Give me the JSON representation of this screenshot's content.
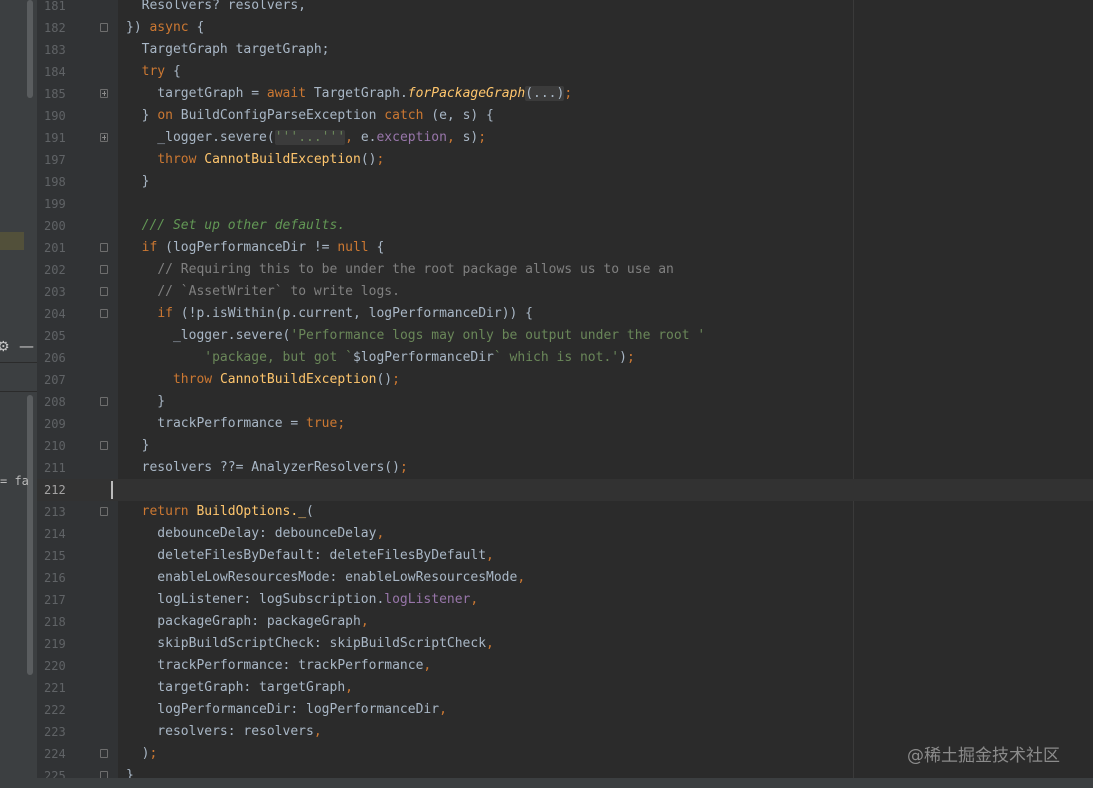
{
  "lines": [
    {
      "num": "181",
      "indent": 0,
      "fold": "",
      "parts": [
        [
          "",
          "  Resolvers? resolvers,"
        ]
      ]
    },
    {
      "num": "182",
      "indent": 0,
      "fold": "start",
      "parts": [
        [
          "",
          "}) "
        ],
        [
          "kw",
          "async"
        ],
        [
          "",
          " {"
        ]
      ]
    },
    {
      "num": "183",
      "indent": 0,
      "fold": "",
      "parts": [
        [
          "",
          "  TargetGraph targetGraph;"
        ]
      ]
    },
    {
      "num": "184",
      "indent": 0,
      "fold": "",
      "parts": [
        [
          "",
          "  "
        ],
        [
          "kw",
          "try"
        ],
        [
          "",
          " {"
        ]
      ]
    },
    {
      "num": "185",
      "indent": 0,
      "fold": "plus",
      "parts": [
        [
          "",
          "    targetGraph = "
        ],
        [
          "kw",
          "await"
        ],
        [
          "",
          " TargetGraph."
        ],
        [
          "fni",
          "forPackageGraph"
        ],
        [
          "fold-text",
          "(...)"
        ],
        [
          "kw",
          ";"
        ]
      ]
    },
    {
      "num": "190",
      "indent": 0,
      "fold": "",
      "parts": [
        [
          "",
          "  } "
        ],
        [
          "kw",
          "on"
        ],
        [
          "",
          " BuildConfigParseException "
        ],
        [
          "kw",
          "catch"
        ],
        [
          "",
          " (e, s) {"
        ]
      ]
    },
    {
      "num": "191",
      "indent": 0,
      "fold": "plus",
      "parts": [
        [
          "",
          "    _logger.severe("
        ],
        [
          "str-fold",
          "'''...'''"
        ],
        [
          "kw",
          ","
        ],
        [
          "",
          " e."
        ],
        [
          "prop",
          "exception"
        ],
        [
          "kw",
          ","
        ],
        [
          "",
          " s)"
        ],
        [
          "kw",
          ";"
        ]
      ]
    },
    {
      "num": "197",
      "indent": 0,
      "fold": "",
      "parts": [
        [
          "",
          "    "
        ],
        [
          "kw",
          "throw"
        ],
        [
          "",
          " "
        ],
        [
          "fn",
          "CannotBuildException"
        ],
        [
          "",
          "()"
        ],
        [
          "kw",
          ";"
        ]
      ]
    },
    {
      "num": "198",
      "indent": 0,
      "fold": "",
      "parts": [
        [
          "",
          "  }"
        ]
      ]
    },
    {
      "num": "199",
      "indent": 0,
      "fold": "",
      "parts": [
        [
          "",
          ""
        ]
      ]
    },
    {
      "num": "200",
      "indent": 0,
      "fold": "",
      "parts": [
        [
          "",
          "  "
        ],
        [
          "doc",
          "/// Set up other defaults."
        ]
      ]
    },
    {
      "num": "201",
      "indent": 0,
      "fold": "start",
      "parts": [
        [
          "",
          "  "
        ],
        [
          "kw",
          "if"
        ],
        [
          "",
          " (logPerformanceDir != "
        ],
        [
          "kw",
          "null"
        ],
        [
          "",
          " {"
        ]
      ]
    },
    {
      "num": "202",
      "indent": 0,
      "fold": "start",
      "parts": [
        [
          "",
          "    "
        ],
        [
          "cm",
          "// Requiring this to be under the root package allows us to use an"
        ]
      ]
    },
    {
      "num": "203",
      "indent": 0,
      "fold": "end",
      "parts": [
        [
          "",
          "    "
        ],
        [
          "cm",
          "// `AssetWriter` to write logs."
        ]
      ]
    },
    {
      "num": "204",
      "indent": 0,
      "fold": "start",
      "parts": [
        [
          "",
          "    "
        ],
        [
          "kw",
          "if"
        ],
        [
          "",
          " (!p.isWithin(p.current, logPerformanceDir)) {"
        ]
      ]
    },
    {
      "num": "205",
      "indent": 0,
      "fold": "",
      "parts": [
        [
          "",
          "      _logger.severe("
        ],
        [
          "str",
          "'Performance logs may only be output under the root '"
        ]
      ]
    },
    {
      "num": "206",
      "indent": 0,
      "fold": "",
      "parts": [
        [
          "",
          "          "
        ],
        [
          "str",
          "'package, but got `"
        ],
        [
          "",
          "$logPerformanceDir"
        ],
        [
          "str",
          "` which is not.'"
        ],
        [
          "",
          ")"
        ],
        [
          "kw",
          ";"
        ]
      ]
    },
    {
      "num": "207",
      "indent": 0,
      "fold": "",
      "parts": [
        [
          "",
          "      "
        ],
        [
          "kw",
          "throw"
        ],
        [
          "",
          " "
        ],
        [
          "fn",
          "CannotBuildException"
        ],
        [
          "",
          "()"
        ],
        [
          "kw",
          ";"
        ]
      ]
    },
    {
      "num": "208",
      "indent": 0,
      "fold": "end",
      "parts": [
        [
          "",
          "    }"
        ]
      ]
    },
    {
      "num": "209",
      "indent": 0,
      "fold": "",
      "parts": [
        [
          "",
          "    trackPerformance = "
        ],
        [
          "kw",
          "true"
        ],
        [
          "kw",
          ";"
        ]
      ]
    },
    {
      "num": "210",
      "indent": 0,
      "fold": "end",
      "parts": [
        [
          "",
          "  }"
        ]
      ]
    },
    {
      "num": "211",
      "indent": 0,
      "fold": "",
      "parts": [
        [
          "",
          "  resolvers ??= AnalyzerResolvers()"
        ],
        [
          "kw",
          ";"
        ]
      ]
    },
    {
      "num": "212",
      "indent": 0,
      "fold": "",
      "current": true,
      "parts": [
        [
          "",
          ""
        ]
      ]
    },
    {
      "num": "213",
      "indent": 0,
      "fold": "start",
      "parts": [
        [
          "",
          "  "
        ],
        [
          "kw",
          "return"
        ],
        [
          "",
          " "
        ],
        [
          "fn",
          "BuildOptions._"
        ],
        [
          "",
          "("
        ]
      ]
    },
    {
      "num": "214",
      "indent": 0,
      "fold": "",
      "parts": [
        [
          "",
          "    debounceDelay: debounceDelay"
        ],
        [
          "kw",
          ","
        ]
      ]
    },
    {
      "num": "215",
      "indent": 0,
      "fold": "",
      "parts": [
        [
          "",
          "    deleteFilesByDefault: deleteFilesByDefault"
        ],
        [
          "kw",
          ","
        ]
      ]
    },
    {
      "num": "216",
      "indent": 0,
      "fold": "",
      "parts": [
        [
          "",
          "    enableLowResourcesMode: enableLowResourcesMode"
        ],
        [
          "kw",
          ","
        ]
      ]
    },
    {
      "num": "217",
      "indent": 0,
      "fold": "",
      "parts": [
        [
          "",
          "    logListener: logSubscription."
        ],
        [
          "prop",
          "logListener"
        ],
        [
          "kw",
          ","
        ]
      ]
    },
    {
      "num": "218",
      "indent": 0,
      "fold": "",
      "parts": [
        [
          "",
          "    packageGraph: packageGraph"
        ],
        [
          "kw",
          ","
        ]
      ]
    },
    {
      "num": "219",
      "indent": 0,
      "fold": "",
      "parts": [
        [
          "",
          "    skipBuildScriptCheck: skipBuildScriptCheck"
        ],
        [
          "kw",
          ","
        ]
      ]
    },
    {
      "num": "220",
      "indent": 0,
      "fold": "",
      "parts": [
        [
          "",
          "    trackPerformance: trackPerformance"
        ],
        [
          "kw",
          ","
        ]
      ]
    },
    {
      "num": "221",
      "indent": 0,
      "fold": "",
      "parts": [
        [
          "",
          "    targetGraph: targetGraph"
        ],
        [
          "kw",
          ","
        ]
      ]
    },
    {
      "num": "222",
      "indent": 0,
      "fold": "",
      "parts": [
        [
          "",
          "    logPerformanceDir: logPerformanceDir"
        ],
        [
          "kw",
          ","
        ]
      ]
    },
    {
      "num": "223",
      "indent": 0,
      "fold": "",
      "parts": [
        [
          "",
          "    resolvers: resolvers"
        ],
        [
          "kw",
          ","
        ]
      ]
    },
    {
      "num": "224",
      "indent": 0,
      "fold": "end",
      "parts": [
        [
          "",
          "  )"
        ],
        [
          "kw",
          ";"
        ]
      ]
    },
    {
      "num": "225",
      "indent": 0,
      "fold": "end",
      "parts": [
        [
          "",
          "}"
        ]
      ]
    }
  ],
  "left_panel": {
    "gear_icon": "⚙",
    "minus_icon": "—",
    "snippet_text": "= fa"
  },
  "watermark": "@稀土掘金技术社区",
  "colors": {
    "background": "#2b2b2b",
    "gutter": "#313335",
    "keyword": "#cc7832",
    "string": "#6a8759",
    "function": "#ffc66d",
    "comment": "#808080",
    "doc_comment": "#629755",
    "property": "#9876aa",
    "text": "#a9b7c6"
  }
}
